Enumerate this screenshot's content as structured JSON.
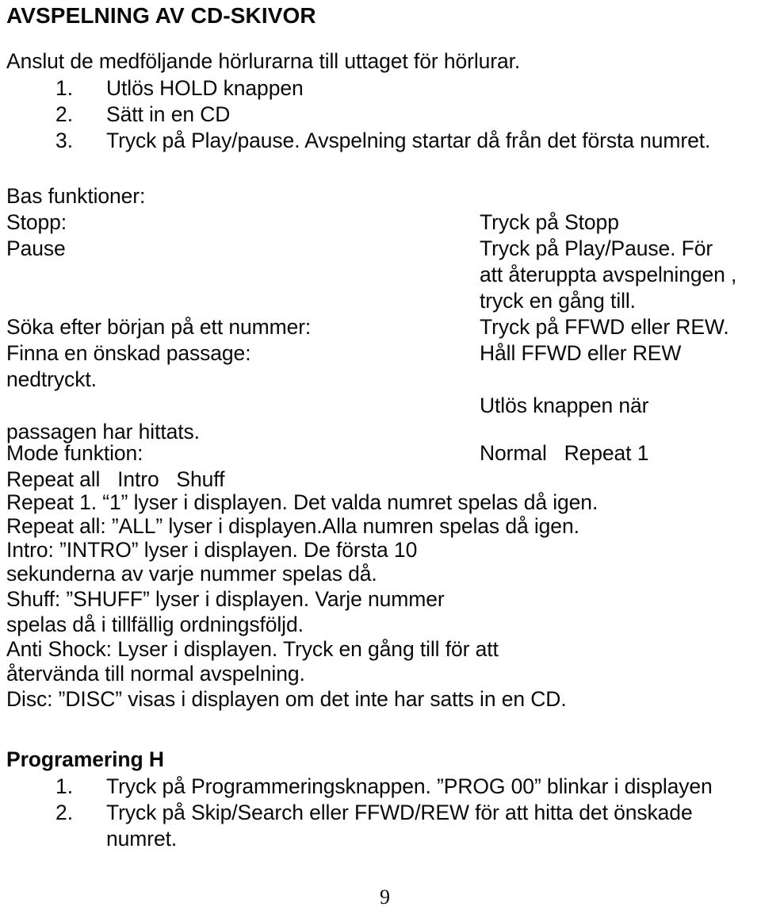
{
  "document": {
    "type": "scanned-manual-page",
    "language": "sv",
    "page_number": "9"
  },
  "heading": {
    "title": "AVSPELNING AV CD-SKIVOR"
  },
  "intro": {
    "lead": "Anslut de medföljande hörlurarna till uttaget för hörlurar.",
    "steps": [
      {
        "marker": "1.",
        "text": "Utlös HOLD knappen"
      },
      {
        "marker": "2.",
        "text": "Sätt in en CD"
      },
      {
        "marker": "3.",
        "text": "Tryck på Play/pause. Avspelning startar då från det första numret."
      }
    ]
  },
  "base_functions": {
    "heading": "Bas funktioner:",
    "rows": [
      {
        "label": "Stopp:",
        "value": "Tryck på Stopp"
      },
      {
        "label": "Pause",
        "value": "Tryck på Play/Pause. För"
      }
    ],
    "value_continuation_1": "att återuppta avspelningen ,",
    "value_continuation_2": "tryck en gång till.",
    "row_seek": {
      "label": "Söka efter början på ett nummer:",
      "value": "Tryck på FFWD eller REW."
    },
    "row_passage": {
      "label": "Finna en önskad passage:",
      "value": "Håll FFWD eller REW"
    },
    "label_continuation_1": "nedtryckt.",
    "value_continuation_3": "Utlös knappen när",
    "label_continuation_2": "passagen har hittats.",
    "row_mode": {
      "label": "Mode funktion:",
      "value": "Normal   Repeat 1"
    },
    "mode_options_continuation": "Repeat all   Intro   Shuff"
  },
  "mode_descriptions": {
    "lines": [
      "Repeat 1. “1” lyser i displayen. Det valda numret spelas då igen.",
      "Repeat all: ”ALL” lyser i displayen.Alla numren spelas då igen.",
      "Intro: ”INTRO” lyser i displayen. De första 10",
      "sekunderna av varje nummer spelas då.",
      "Shuff: ”SHUFF” lyser i displayen. Varje nummer",
      "spelas då i tillfällig ordningsföljd.",
      "Anti Shock: Lyser i displayen. Tryck en gång till för att",
      "återvända till normal avspelning.",
      "Disc: ”DISC” visas i displayen om det inte har satts in en CD."
    ]
  },
  "programming": {
    "heading": "Programering H",
    "steps": [
      {
        "marker": "1.",
        "text": "Tryck på Programmeringsknappen. ”PROG 00” blinkar i displayen"
      },
      {
        "marker": "2.",
        "text": "Tryck på Skip/Search eller FFWD/REW för att hitta det önskade"
      },
      {
        "marker": "",
        "text": "numret."
      }
    ]
  },
  "footer": {
    "page_number": "9"
  }
}
